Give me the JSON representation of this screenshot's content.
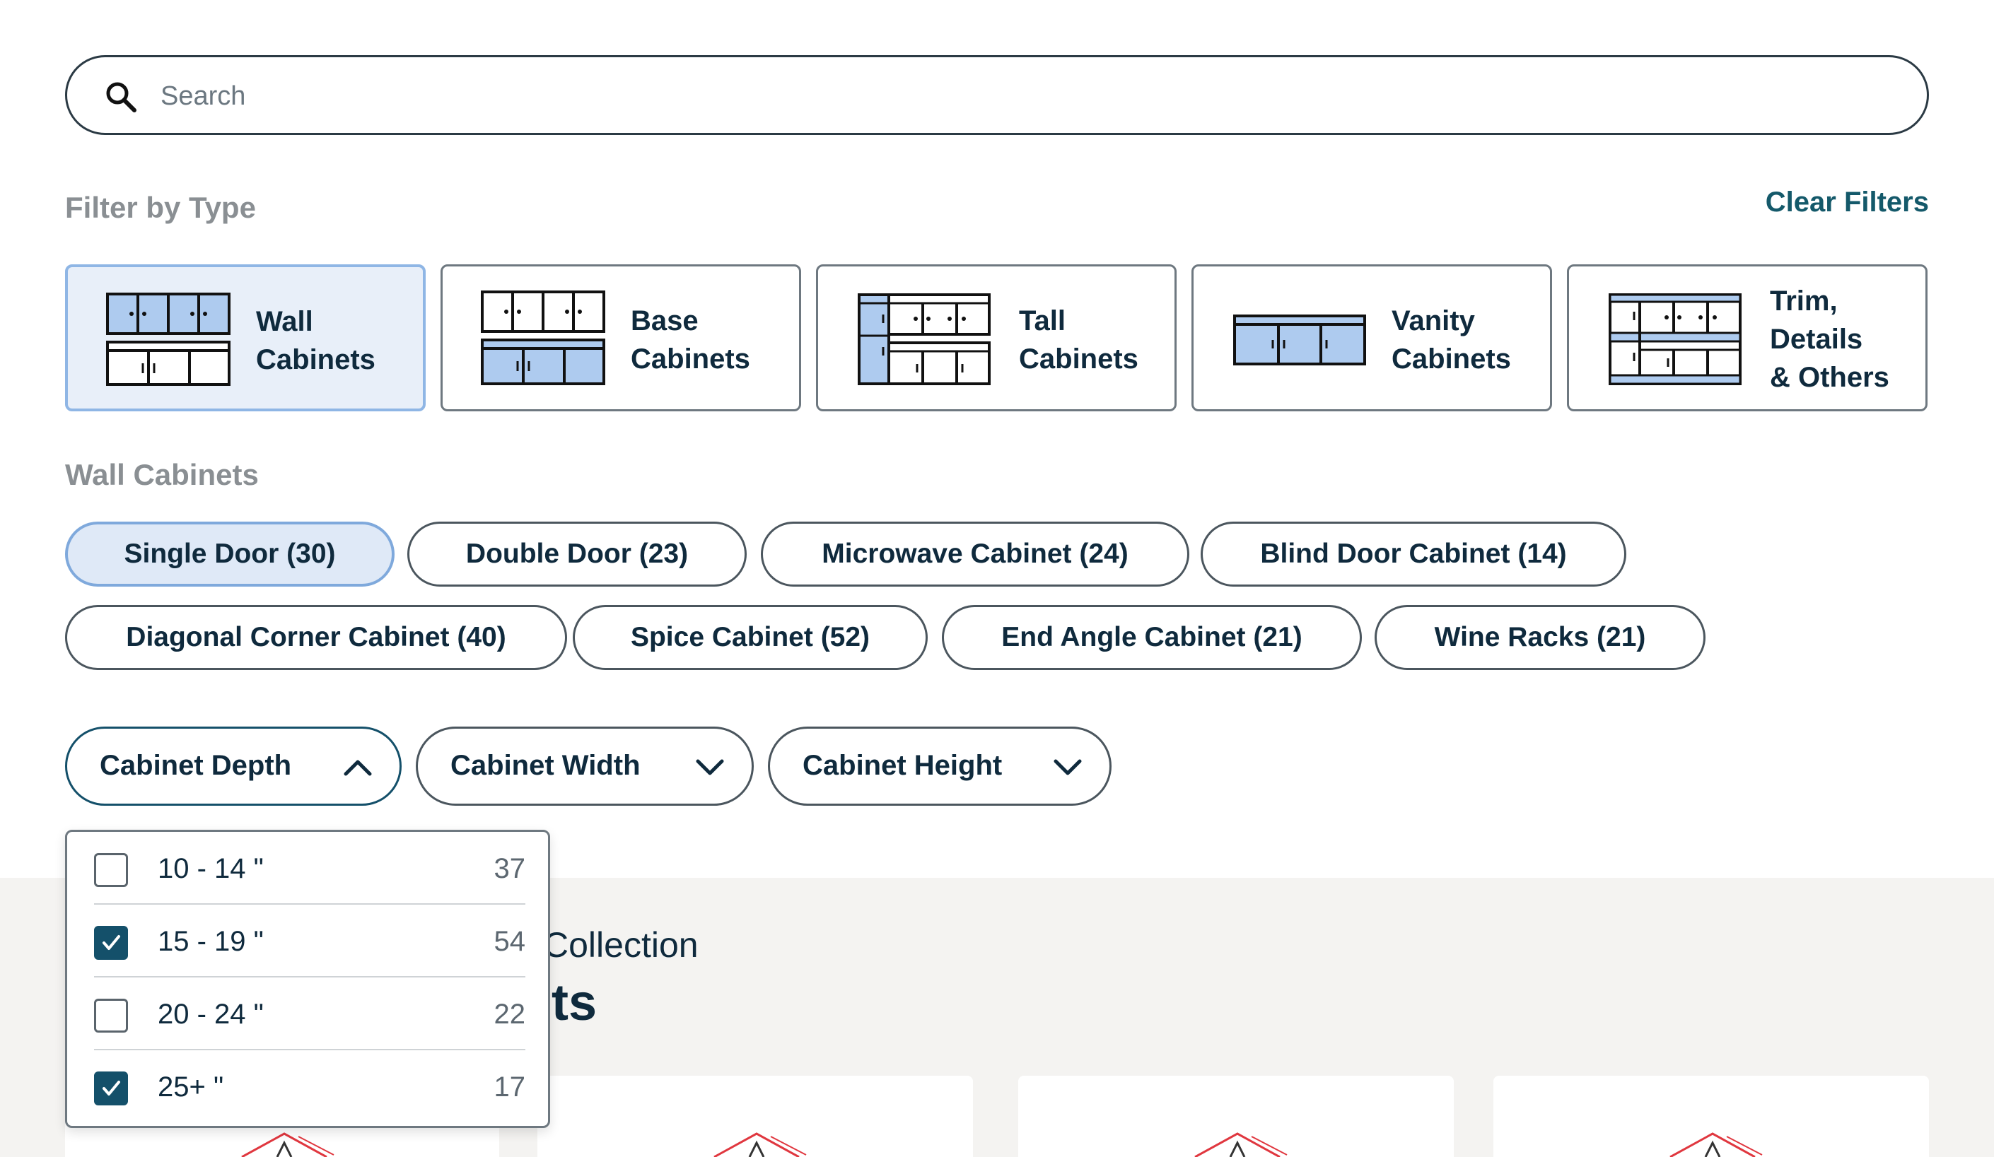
{
  "search": {
    "placeholder": "Search",
    "icon": "search-icon"
  },
  "filter_by_type": {
    "heading": "Filter by Type",
    "clear_label": "Clear Filters",
    "types": [
      {
        "line1": "Wall",
        "line2": "Cabinets",
        "selected": true
      },
      {
        "line1": "Base",
        "line2": "Cabinets",
        "selected": false
      },
      {
        "line1": "Tall",
        "line2": "Cabinets",
        "selected": false
      },
      {
        "line1": "Vanity",
        "line2": "Cabinets",
        "selected": false
      },
      {
        "line1": "Trim,",
        "line2": "Details",
        "line3": "& Others",
        "selected": false
      }
    ]
  },
  "subcategory": {
    "heading": "Wall Cabinets",
    "pills": [
      {
        "label": "Single Door (30)",
        "selected": true
      },
      {
        "label": "Double Door (23)",
        "selected": false
      },
      {
        "label": "Microwave Cabinet (24)",
        "selected": false
      },
      {
        "label": "Blind Door Cabinet (14)",
        "selected": false
      },
      {
        "label": "Diagonal Corner Cabinet (40)",
        "selected": false
      },
      {
        "label": "Spice Cabinet (52)",
        "selected": false
      },
      {
        "label": "End Angle Cabinet (21)",
        "selected": false
      },
      {
        "label": "Wine Racks (21)",
        "selected": false
      }
    ]
  },
  "dropdowns": [
    {
      "label": "Cabinet Depth",
      "open": true,
      "icon": "chevron-up-icon"
    },
    {
      "label": "Cabinet Width",
      "open": false,
      "icon": "chevron-down-icon"
    },
    {
      "label": "Cabinet Height",
      "open": false,
      "icon": "chevron-down-icon"
    }
  ],
  "depth_options": [
    {
      "label": "10 - 14 \"",
      "count": "37",
      "checked": false
    },
    {
      "label": "15 - 19 \"",
      "count": "54",
      "checked": true
    },
    {
      "label": "20 - 24 \"",
      "count": "22",
      "checked": false
    },
    {
      "label": "25+ \"",
      "count": "17",
      "checked": true
    }
  ],
  "results": {
    "collection_fragment": "Collection",
    "results_fragment": "lts"
  },
  "colors": {
    "accent_dark": "#14506a",
    "selected_bg": "#e8eff9",
    "selected_border": "#8fb6e5",
    "cabinet_fill": "#aecbef",
    "drawing_red": "#e0373f"
  }
}
